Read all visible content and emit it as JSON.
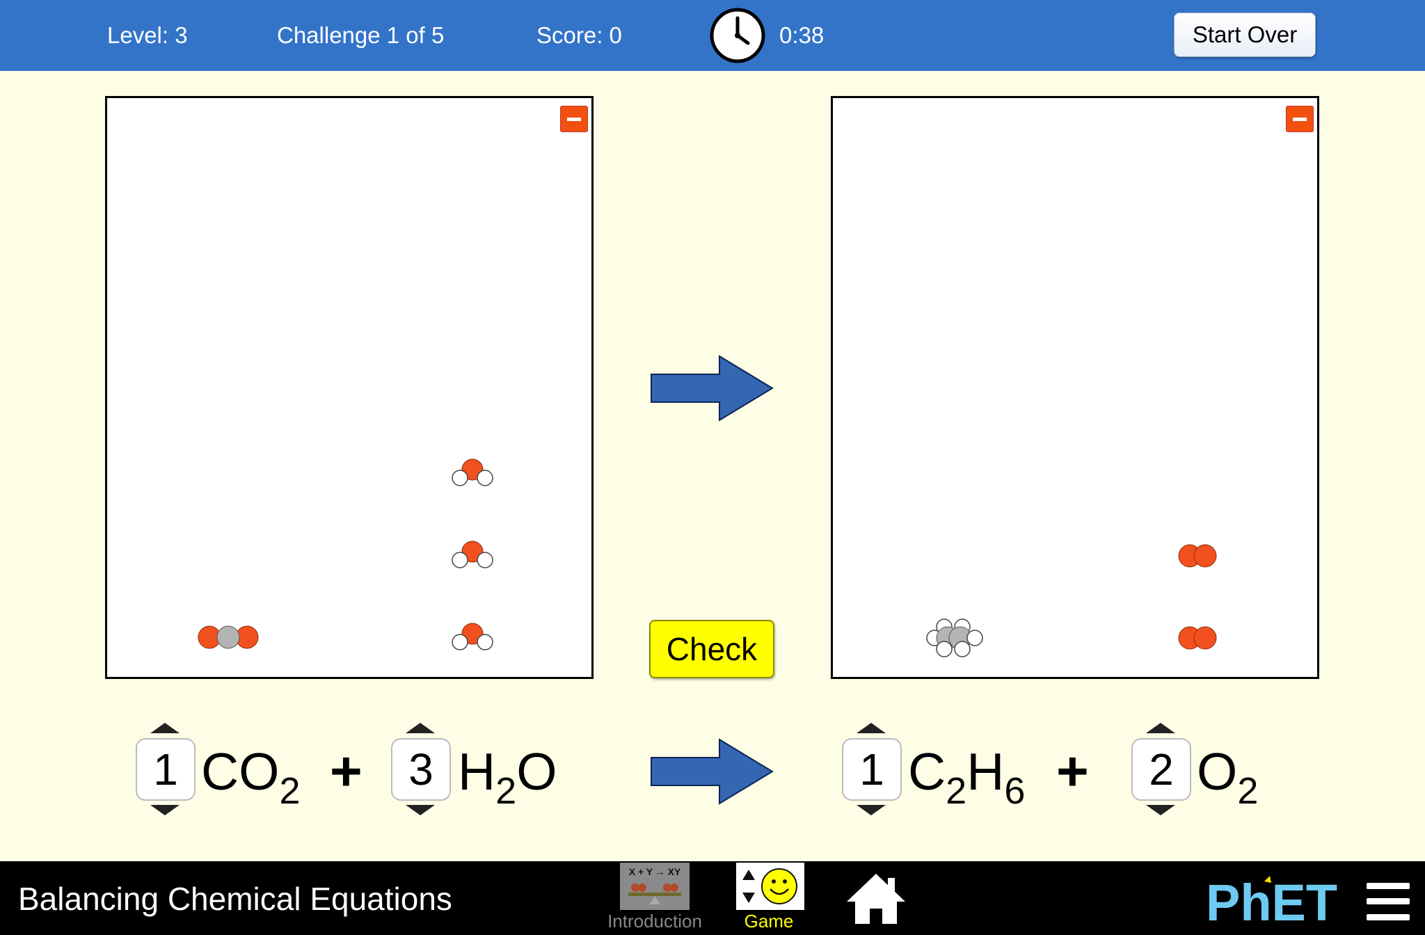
{
  "status_bar": {
    "level": "Level: 3",
    "challenge": "Challenge 1 of 5",
    "score": "Score: 0",
    "timer": "0:38",
    "start_over": "Start Over",
    "bar_color": "#3374c9"
  },
  "check_button": {
    "label": "Check",
    "color": "#ffff00"
  },
  "equation": {
    "reactants": [
      {
        "coefficient": "1",
        "formula_parts": [
          "CO",
          "2"
        ]
      },
      {
        "coefficient": "3",
        "formula_parts": [
          "H",
          "2",
          "O"
        ]
      }
    ],
    "products": [
      {
        "coefficient": "1",
        "formula_parts": [
          "C",
          "2",
          "H",
          "6"
        ]
      },
      {
        "coefficient": "2",
        "formula_parts": [
          "O",
          "2"
        ]
      }
    ],
    "plus": "+"
  },
  "nav_bar": {
    "title": "Balancing Chemical Equations",
    "screens": [
      {
        "label": "Introduction",
        "icon_text": "X + Y → XY",
        "selected": false
      },
      {
        "label": "Game",
        "selected": true
      }
    ],
    "home_icon": "home-icon",
    "logo": "PhET",
    "menu_icon": "hamburger-menu-icon"
  },
  "colors": {
    "background": "#fefee6",
    "oxygen": "#f2501e",
    "carbon": "#aaaaaa",
    "hydrogen": "#ffffff",
    "arrow": "#3466b2",
    "collapse_button": "#f2500f",
    "phet_blue": "#6fcaf1",
    "phet_yellow": "#fde200"
  }
}
